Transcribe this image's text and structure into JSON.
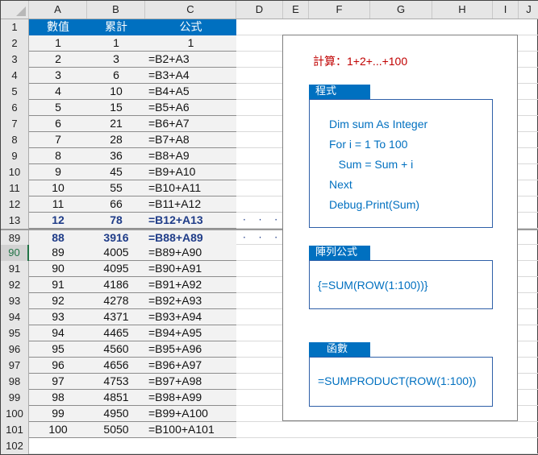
{
  "columns": [
    "A",
    "B",
    "C",
    "D",
    "E",
    "F",
    "G",
    "H",
    "I",
    "J"
  ],
  "header_row": {
    "row": "1",
    "a": "數值",
    "b": "累計",
    "c": "公式"
  },
  "rows_top": [
    {
      "row": "2",
      "a": "1",
      "b": "1",
      "c": "1"
    },
    {
      "row": "3",
      "a": "2",
      "b": "3",
      "c": "=B2+A3"
    },
    {
      "row": "4",
      "a": "3",
      "b": "6",
      "c": "=B3+A4"
    },
    {
      "row": "5",
      "a": "4",
      "b": "10",
      "c": "=B4+A5"
    },
    {
      "row": "6",
      "a": "5",
      "b": "15",
      "c": "=B5+A6"
    },
    {
      "row": "7",
      "a": "6",
      "b": "21",
      "c": "=B6+A7"
    },
    {
      "row": "8",
      "a": "7",
      "b": "28",
      "c": "=B7+A8"
    },
    {
      "row": "9",
      "a": "8",
      "b": "36",
      "c": "=B8+A9"
    },
    {
      "row": "10",
      "a": "9",
      "b": "45",
      "c": "=B9+A10"
    },
    {
      "row": "11",
      "a": "10",
      "b": "55",
      "c": "=B10+A11"
    },
    {
      "row": "12",
      "a": "11",
      "b": "66",
      "c": "=B11+A12"
    },
    {
      "row": "13",
      "a": "12",
      "b": "78",
      "c": "=B12+A13"
    }
  ],
  "rows_bottom": [
    {
      "row": "89",
      "a": "88",
      "b": "3916",
      "c": "=B88+A89"
    },
    {
      "row": "90",
      "a": "89",
      "b": "4005",
      "c": "=B89+A90"
    },
    {
      "row": "91",
      "a": "90",
      "b": "4095",
      "c": "=B90+A91"
    },
    {
      "row": "92",
      "a": "91",
      "b": "4186",
      "c": "=B91+A92"
    },
    {
      "row": "93",
      "a": "92",
      "b": "4278",
      "c": "=B92+A93"
    },
    {
      "row": "94",
      "a": "93",
      "b": "4371",
      "c": "=B93+A94"
    },
    {
      "row": "95",
      "a": "94",
      "b": "4465",
      "c": "=B94+A95"
    },
    {
      "row": "96",
      "a": "95",
      "b": "4560",
      "c": "=B95+A96"
    },
    {
      "row": "97",
      "a": "96",
      "b": "4656",
      "c": "=B96+A97"
    },
    {
      "row": "98",
      "a": "97",
      "b": "4753",
      "c": "=B97+A98"
    },
    {
      "row": "99",
      "a": "98",
      "b": "4851",
      "c": "=B98+A99"
    },
    {
      "row": "100",
      "a": "99",
      "b": "4950",
      "c": "=B99+A100"
    },
    {
      "row": "101",
      "a": "100",
      "b": "5050",
      "c": "=B100+A101"
    }
  ],
  "last_row": "102",
  "selected_row": "90",
  "ellipsis": "· · ·",
  "panel": {
    "title": "計算：1+2+...+100",
    "program": {
      "tag": "程式",
      "lines": [
        "Dim sum As Integer",
        "For i = 1 To 100",
        "   Sum = Sum + i",
        "Next",
        "Debug.Print(Sum)"
      ]
    },
    "array_formula": {
      "tag": "陣列公式",
      "text": "{=SUM(ROW(1:100))}"
    },
    "function": {
      "tag": "函數",
      "text": "=SUMPRODUCT(ROW(1:100))"
    }
  }
}
